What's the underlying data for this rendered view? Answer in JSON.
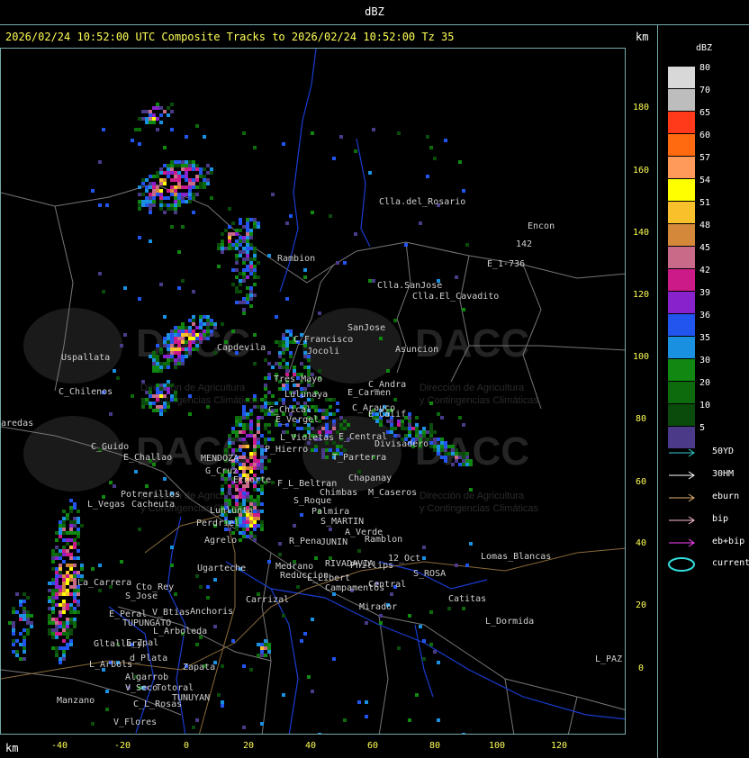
{
  "top_title": "dBZ",
  "header": "2026/02/24 10:52:00 UTC Composite Tracks to 2026/02/24 10:52:00 Tz 35",
  "km_label": "km",
  "legend": {
    "title": "dBZ",
    "entries": [
      {
        "value": "80",
        "color": "#d8d8d8"
      },
      {
        "value": "70",
        "color": "#bdbdbd"
      },
      {
        "value": "65",
        "color": "#ff3a1a"
      },
      {
        "value": "60",
        "color": "#ff6a10"
      },
      {
        "value": "57",
        "color": "#ff9a5a"
      },
      {
        "value": "54",
        "color": "#ffff00"
      },
      {
        "value": "51",
        "color": "#f8c02a"
      },
      {
        "value": "48",
        "color": "#d4883a"
      },
      {
        "value": "45",
        "color": "#c86a88"
      },
      {
        "value": "42",
        "color": "#cc1a88"
      },
      {
        "value": "39",
        "color": "#8822cc"
      },
      {
        "value": "36",
        "color": "#2255ee"
      },
      {
        "value": "35",
        "color": "#1a90e0"
      },
      {
        "value": "30",
        "color": "#118811"
      },
      {
        "value": "20",
        "color": "#0d6a0d"
      },
      {
        "value": "10",
        "color": "#0a4a0a"
      },
      {
        "value": "5",
        "color": "#4a3a88"
      }
    ]
  },
  "tracks": [
    {
      "label": "50YD",
      "color": "#33cccc"
    },
    {
      "label": "30HM",
      "color": "#ffffff"
    },
    {
      "label": "eburn",
      "color": "#e0b070"
    },
    {
      "label": "bip",
      "color": "#ffc0d0"
    },
    {
      "label": "eb+bip",
      "color": "#ff44ff"
    },
    {
      "label": "current",
      "color": "#33dddd"
    }
  ],
  "y_ticks": [
    "180",
    "160",
    "140",
    "120",
    "100",
    "80",
    "60",
    "40",
    "20",
    "0"
  ],
  "x_ticks": [
    "-40",
    "-20",
    "0",
    "20",
    "40",
    "60",
    "80",
    "100",
    "120"
  ],
  "watermark": {
    "name": "DACC",
    "line1": "Dirección de Agricultura",
    "line2": "y Contingencias Climáticas"
  },
  "places": [
    "Clla.del_Rosario",
    "Encon",
    "142",
    "E_1-736",
    "Rambion",
    "Clla.SanJose",
    "Clla.El_Cavadito",
    "Uspallata",
    "C_Chilenos",
    "aredas",
    "Potrerillos",
    "Cacheuta",
    "L_Vegas",
    "C_Guido",
    "E_Challao",
    "Capdevila",
    "C_Francisco",
    "Jocoli",
    "SanJose",
    "Asuncion",
    "Tres_Mayo",
    "Lulunaya",
    "C_Andra",
    "E_Carmen",
    "C_Chical",
    "E_Vergel",
    "C_Arauco",
    "E_Calif",
    "L_Violetas",
    "E_Central",
    "Divisadero",
    "P_Hierro",
    "T_Parterra",
    "MENDOZA",
    "G_Cruz",
    "Ecnorte",
    "Chapanay",
    "F_L_Beltran",
    "Chimbas",
    "M_Caseros",
    "S_Roque",
    "Palmira",
    "S_MARTIN",
    "A_Verde",
    "Ramblon",
    "Perdriel",
    "Lunlunta",
    "Agrelo",
    "R_Pena",
    "JUNIN",
    "Ugarteche",
    "Medrano",
    "Reduccion",
    "RIVADAVIA",
    "Phillips",
    "12_Oct",
    "L_Libert",
    "S_ROSA",
    "Lomas_Blancas",
    "Campamentos",
    "Central",
    "La_Carrera",
    "Cto_Rey",
    "S_Jose",
    "E_Peral",
    "V_Btias",
    "TUPUNGATO",
    "Anchoris",
    "Carrizal",
    "Mirador",
    "Catitas",
    "L_Dormida",
    "L_Arboleda",
    "E_Zpal",
    "Gltallary",
    "L_Arbols",
    "d_Plata",
    "Zapata",
    "Algarrob",
    "V_Seco",
    "Totoral",
    "Manzano",
    "C_L_Rosas",
    "TUNUYAN",
    "V_Flores",
    "L_PAZ"
  ]
}
